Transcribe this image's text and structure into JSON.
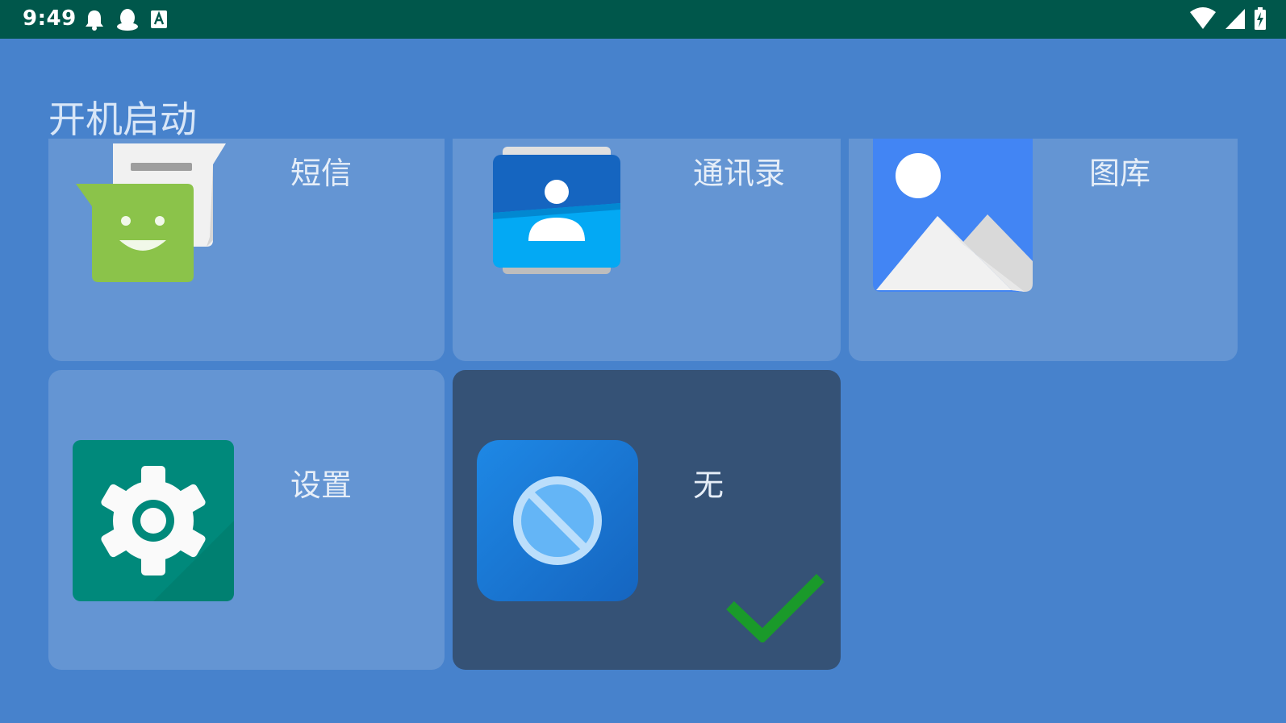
{
  "status_bar": {
    "time": "9:49",
    "left_icons": [
      "notification-bell-icon",
      "qq-penguin-icon",
      "text-a-icon"
    ],
    "right_icons": [
      "wifi-icon",
      "cellular-signal-icon",
      "battery-charging-icon"
    ],
    "background_color": "#00574b"
  },
  "page": {
    "title": "开机启动",
    "background_color": "#4782cc"
  },
  "apps": [
    {
      "label": "短信",
      "icon": "messaging-icon",
      "selected": false
    },
    {
      "label": "通讯录",
      "icon": "contacts-icon",
      "selected": false
    },
    {
      "label": "图库",
      "icon": "gallery-icon",
      "selected": false
    },
    {
      "label": "设置",
      "icon": "settings-gear-icon",
      "selected": false
    },
    {
      "label": "无",
      "icon": "none-prohibited-icon",
      "selected": true,
      "check_icon": "checkmark-icon"
    }
  ],
  "colors": {
    "tile": "#6495d3",
    "tile_selected": "#355276",
    "check": "#1a9a2a"
  }
}
